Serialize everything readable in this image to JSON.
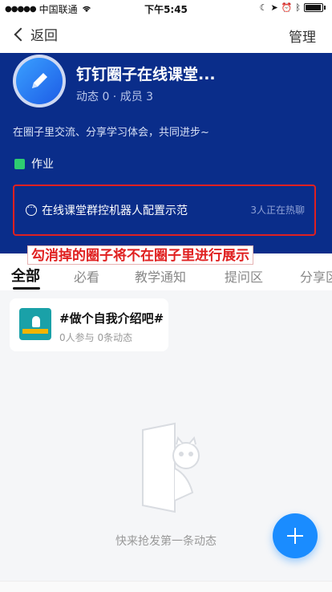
{
  "status_bar": {
    "carrier": "中国联通",
    "time": "下午5:45"
  },
  "nav": {
    "back_label": "返回",
    "manage_label": "管理"
  },
  "circle": {
    "title": "钉钉圈子在线课堂...",
    "stats": "动态 0 · 成员 3",
    "description": "在圈子里交流、分享学习体会，共同进步~",
    "homework_label": "作业",
    "hot_topic": "在线课堂群控机器人配置示范",
    "hot_count": "3人正在热聊"
  },
  "annotation": "勾消掉的圈子将不在圈子里进行展示",
  "tabs": [
    {
      "label": "全部",
      "active": true
    },
    {
      "label": "必看"
    },
    {
      "label": "教学通知"
    },
    {
      "label": "提问区"
    },
    {
      "label": "分享区"
    }
  ],
  "topic_card": {
    "title": "#做个自我介绍吧#",
    "meta": "0人参与  0条动态"
  },
  "empty_state": {
    "text": "快来抢发第一条动态"
  },
  "colors": {
    "header_bg": "#0a2d8a",
    "accent": "#1a8cff",
    "annotation_red": "#e02020"
  }
}
